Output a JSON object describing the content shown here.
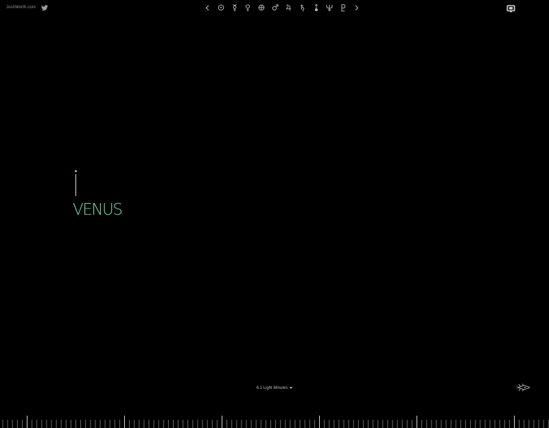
{
  "header": {
    "site_link": "JoshWorth.com",
    "twitter_icon": "twitter-icon",
    "device_icon": "screen-icon"
  },
  "nav": {
    "items": [
      {
        "name": "previous",
        "icon": "chevron-left-icon",
        "glyph": "‹"
      },
      {
        "name": "sun",
        "icon": "sun-icon",
        "glyph": "☉"
      },
      {
        "name": "mercury",
        "icon": "mercury-icon",
        "glyph": "☿"
      },
      {
        "name": "venus",
        "icon": "venus-icon",
        "glyph": "♀"
      },
      {
        "name": "earth",
        "icon": "earth-icon",
        "glyph": "⊕"
      },
      {
        "name": "mars",
        "icon": "mars-icon",
        "glyph": "♂"
      },
      {
        "name": "jupiter",
        "icon": "jupiter-icon",
        "glyph": "♃"
      },
      {
        "name": "saturn",
        "icon": "saturn-icon",
        "glyph": "♄"
      },
      {
        "name": "uranus",
        "icon": "uranus-icon",
        "glyph": "♅"
      },
      {
        "name": "neptune",
        "icon": "neptune-icon",
        "glyph": "♆"
      },
      {
        "name": "pluto",
        "icon": "pluto-icon",
        "glyph": "♇"
      },
      {
        "name": "next",
        "icon": "chevron-right-icon",
        "glyph": "›"
      }
    ]
  },
  "planet": {
    "name": "VENUS"
  },
  "distance": {
    "label": "6.1 Light Minutes"
  },
  "colors": {
    "background": "#000000",
    "accent": "#6fd9ac",
    "text": "#bdbdbd"
  }
}
